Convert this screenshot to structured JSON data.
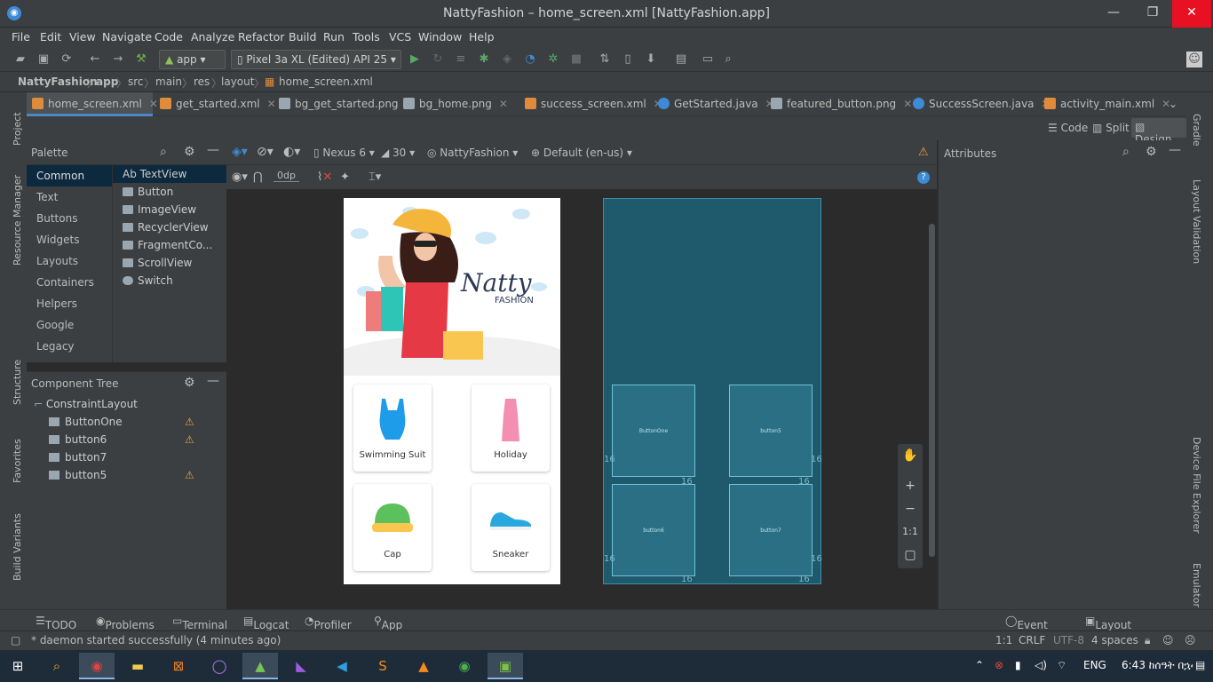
{
  "window": {
    "title": "NattyFashion – home_screen.xml [NattyFashion.app]",
    "controls": [
      "—",
      "❐",
      "✕"
    ]
  },
  "menu": [
    "File",
    "Edit",
    "View",
    "Navigate",
    "Code",
    "Analyze",
    "Refactor",
    "Build",
    "Run",
    "Tools",
    "VCS",
    "Window",
    "Help"
  ],
  "toolbar": {
    "module": "app",
    "device": "Pixel 3a XL (Edited) API 25"
  },
  "breadcrumb": [
    "NattyFashion",
    "app",
    "src",
    "main",
    "res",
    "layout",
    "home_screen.xml"
  ],
  "tabs": [
    "home_screen.xml",
    "get_started.xml",
    "bg_get_started.png",
    "bg_home.png",
    "success_screen.xml",
    "GetStarted.java",
    "featured_button.png",
    "SuccessScreen.java",
    "activity_main.xml"
  ],
  "view_modes": [
    "Code",
    "Split",
    "Design"
  ],
  "palette": {
    "title": "Palette",
    "categories": [
      "Common",
      "Text",
      "Buttons",
      "Widgets",
      "Layouts",
      "Containers",
      "Helpers",
      "Google",
      "Legacy"
    ],
    "items": [
      "Ab TextView",
      "Button",
      "ImageView",
      "RecyclerView",
      "FragmentCo...",
      "ScrollView",
      "Switch"
    ]
  },
  "component_tree": {
    "title": "Component Tree",
    "root": "ConstraintLayout",
    "children": [
      {
        "name": "ButtonOne",
        "warn": true
      },
      {
        "name": "button6",
        "warn": true
      },
      {
        "name": "button7",
        "warn": false
      },
      {
        "name": "button5",
        "warn": true
      }
    ]
  },
  "design_toolbar": {
    "device": "Nexus 6",
    "api": "30",
    "theme": "NattyFashion",
    "locale": "Default (en-us)",
    "margin": "0dp"
  },
  "attributes": {
    "title": "Attributes"
  },
  "phone": {
    "logo_main": "Natty",
    "logo_sub": "FASHION",
    "cards": [
      "Swimming Suit",
      "Holiday",
      "Cap",
      "Sneaker"
    ]
  },
  "blueprint": {
    "buttons": [
      "ButtonOne",
      "button5",
      "button6",
      "button7"
    ],
    "margin": "16"
  },
  "zoom": [
    "✋",
    "+",
    "−",
    "1:1",
    "▢"
  ],
  "left_strip": [
    "Project",
    "Resource Manager",
    "Structure",
    "Favorites",
    "Build Variants"
  ],
  "right_strip": [
    "Gradle",
    "Layout Validation",
    "Device File Explorer",
    "Emulator"
  ],
  "bottom_tools": [
    "TODO",
    "Problems",
    "Terminal",
    "Logcat",
    "Profiler",
    "App Inspection",
    "Event Log",
    "Layout Inspector"
  ],
  "status": {
    "message": "* daemon started successfully (4 minutes ago)",
    "pos": "1:1",
    "crlf": "CRLF",
    "enc": "UTF-8",
    "indent": "4 spaces"
  },
  "taskbar": {
    "lang": "ENG",
    "time": "6:43 ከሰዓት በኋላ"
  }
}
